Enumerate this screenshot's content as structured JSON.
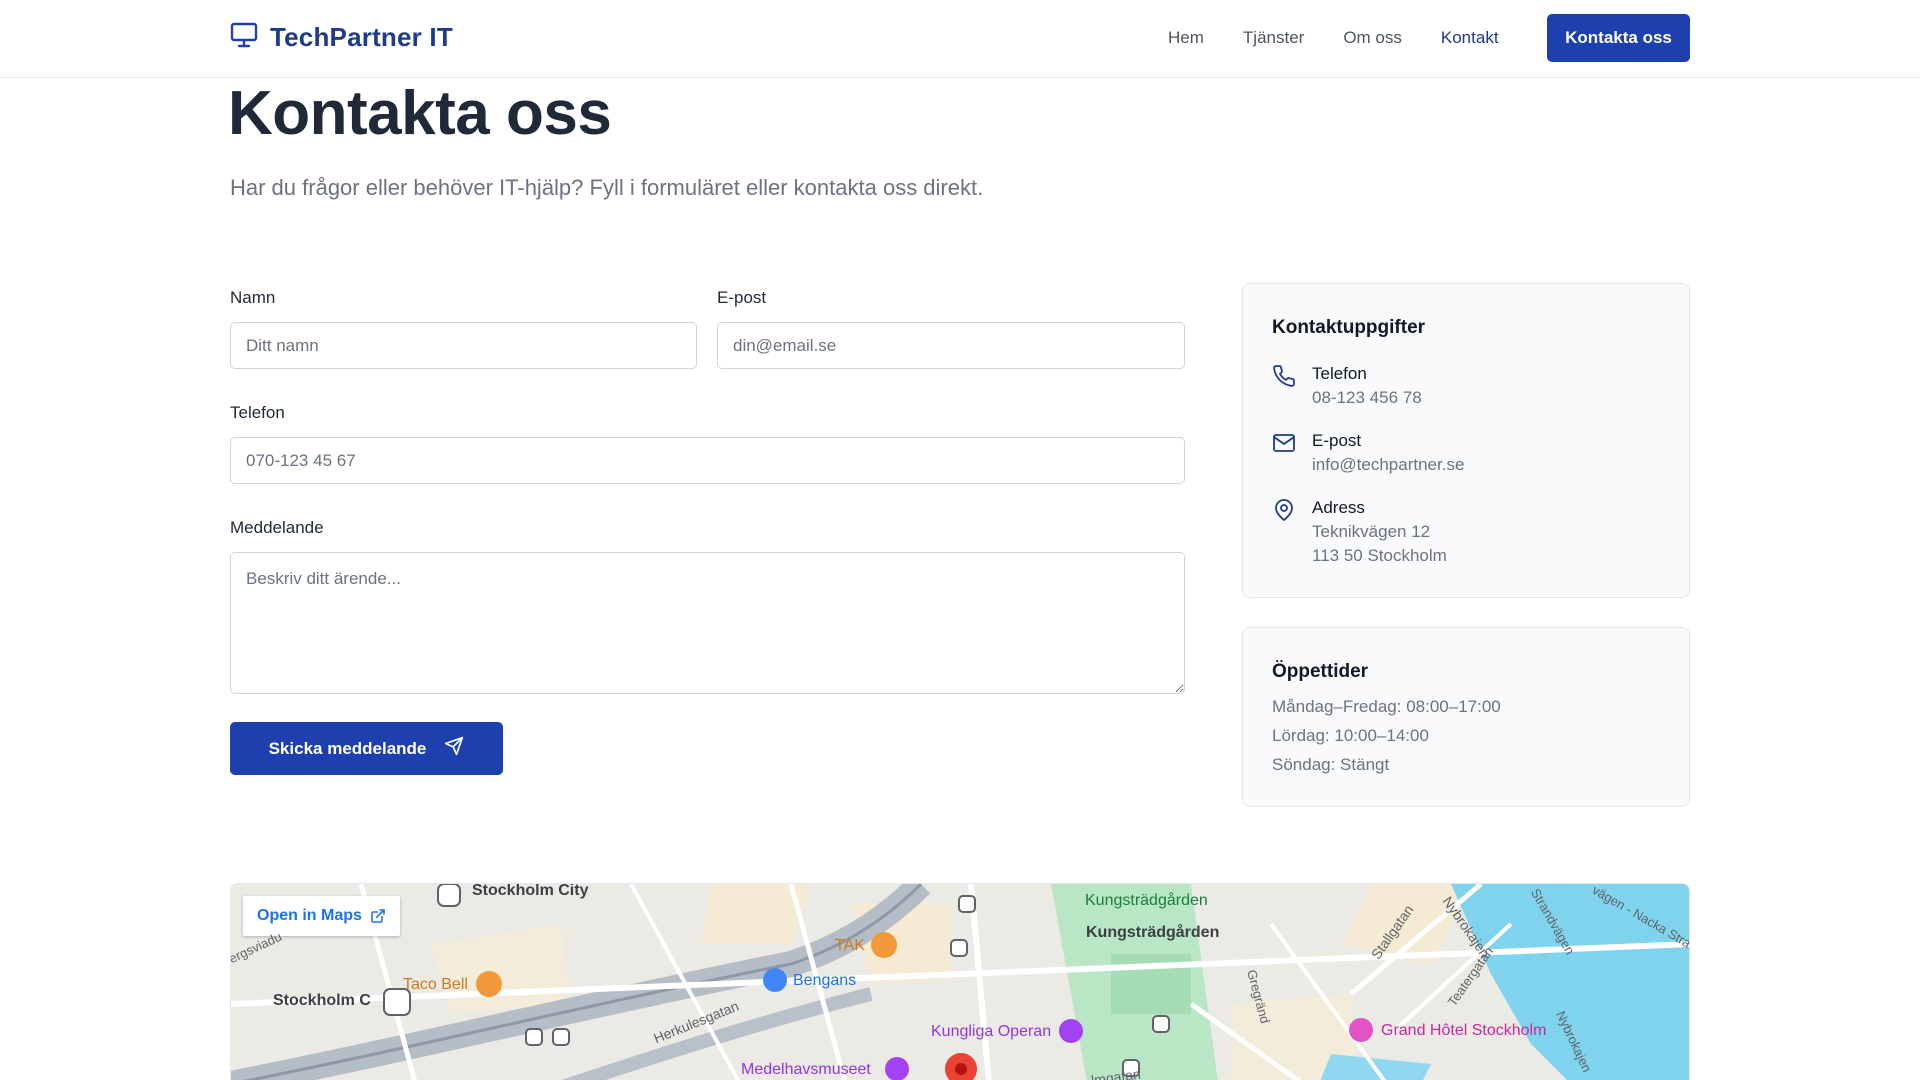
{
  "header": {
    "brand": "TechPartner IT",
    "nav": [
      "Hem",
      "Tjänster",
      "Om oss",
      "Kontakt"
    ],
    "active_nav": "Kontakt",
    "cta": "Kontakta oss",
    "accent_color": "#1e40af"
  },
  "hero": {
    "title": "Kontakta oss",
    "subtitle": "Har du frågor eller behöver IT-hjälp? Fyll i formuläret eller kontakta oss direkt."
  },
  "form": {
    "name": {
      "label": "Namn",
      "placeholder": "Ditt namn",
      "value": ""
    },
    "email": {
      "label": "E-post",
      "placeholder": "din@email.se",
      "value": ""
    },
    "phone": {
      "label": "Telefon",
      "placeholder": "070-123 45 67",
      "value": ""
    },
    "message": {
      "label": "Meddelande",
      "placeholder": "Beskriv ditt ärende...",
      "value": ""
    },
    "submit": "Skicka meddelande"
  },
  "contact_card": {
    "title": "Kontaktuppgifter",
    "phone": {
      "label": "Telefon",
      "value": "08-123 456 78",
      "icon": "phone-icon"
    },
    "email": {
      "label": "E-post",
      "value": "info@techpartner.se",
      "icon": "mail-icon"
    },
    "address": {
      "label": "Adress",
      "line1": "Teknikvägen 12",
      "line2": "113 50 Stockholm",
      "icon": "map-pin-icon"
    }
  },
  "hours_card": {
    "title": "Öppettider",
    "rows": [
      "Måndag–Fredag: 08:00–17:00",
      "Lördag: 10:00–14:00",
      "Söndag: Stängt"
    ]
  },
  "map": {
    "open_label": "Open in Maps",
    "places": {
      "stockholm_city": "Stockholm City",
      "stockholm_c": "Stockholm C",
      "taco_bell": "Taco Bell",
      "tak": "TAK",
      "bengans": "Bengans",
      "kungliga_operan": "Kungliga Operan",
      "medelhavsmuseet": "Medelhavsmuseet",
      "kungstradgarden_park": "Kungsträdgården",
      "kungstradgarden_station": "Kungsträdgården",
      "grand_hotel": "Grand Hôtel Stockholm"
    },
    "streets": {
      "herkulesgatan": "Herkulesgatan",
      "gregrand": "Gregränd",
      "stallgatan": "Stallgatan",
      "teatergatan": "Teatergatan",
      "nybrokajen_1": "Nybrokajen",
      "nybrokajen_2": "Nybrokajen",
      "strandvagen": "Strandvägen",
      "nacka_strand": "vägen - Nacka Stra",
      "bergsviadukten": "ergsviadu",
      "malmtorgsgatan": "lmgatan"
    }
  }
}
